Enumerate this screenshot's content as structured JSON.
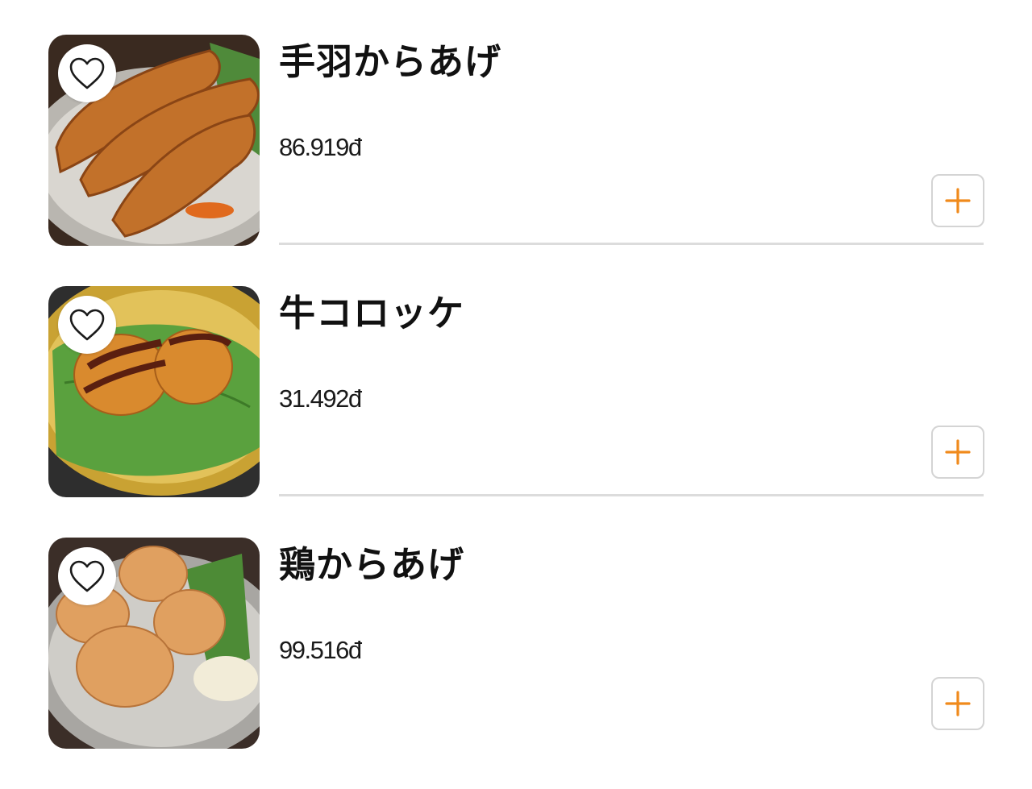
{
  "accent_color": "#f08a1c",
  "items": [
    {
      "name": "手羽からあげ",
      "price": "86.919đ",
      "favorite_icon": "heart-outline-icon",
      "add_icon": "plus-icon"
    },
    {
      "name": "牛コロッケ",
      "price": "31.492đ",
      "favorite_icon": "heart-outline-icon",
      "add_icon": "plus-icon"
    },
    {
      "name": "鶏からあげ",
      "price": "99.516đ",
      "favorite_icon": "heart-outline-icon",
      "add_icon": "plus-icon"
    }
  ]
}
